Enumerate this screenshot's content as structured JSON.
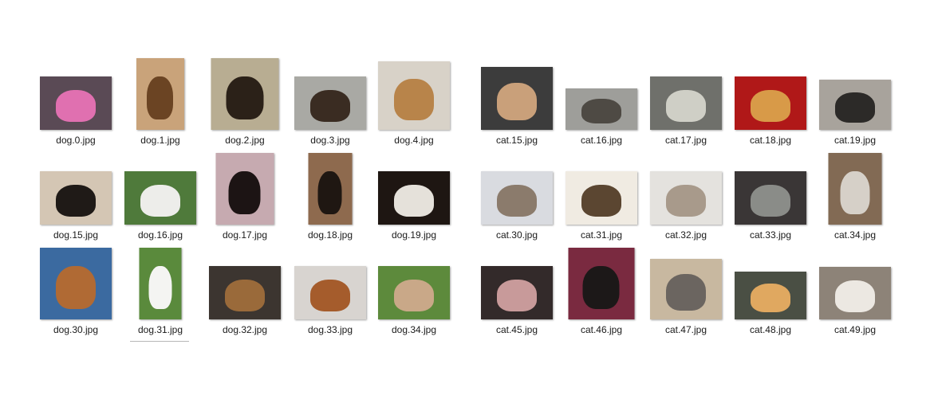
{
  "files": [
    {
      "name": "dog.0.jpg",
      "bg": "#5a4a55",
      "fg": "#e070b0"
    },
    {
      "name": "dog.1.jpg",
      "bg": "#c9a37a",
      "fg": "#6b4423"
    },
    {
      "name": "dog.2.jpg",
      "bg": "#b8ad92",
      "fg": "#2b2118"
    },
    {
      "name": "dog.3.jpg",
      "bg": "#a9a9a4",
      "fg": "#3a2c22"
    },
    {
      "name": "dog.4.jpg",
      "bg": "#d8d2c8",
      "fg": "#b8844a"
    },
    {
      "name": "cat.15.jpg",
      "bg": "#3c3c3c",
      "fg": "#c9a07a"
    },
    {
      "name": "cat.16.jpg",
      "bg": "#9e9e9a",
      "fg": "#4e4a44"
    },
    {
      "name": "cat.17.jpg",
      "bg": "#6f706b",
      "fg": "#cfcfc6"
    },
    {
      "name": "cat.18.jpg",
      "bg": "#b01818",
      "fg": "#d89a48"
    },
    {
      "name": "cat.19.jpg",
      "bg": "#a8a39c",
      "fg": "#2c2a28"
    },
    {
      "name": "dog.15.jpg",
      "bg": "#d4c6b4",
      "fg": "#1f1a17"
    },
    {
      "name": "dog.16.jpg",
      "bg": "#4f7a3b",
      "fg": "#ededea"
    },
    {
      "name": "dog.17.jpg",
      "bg": "#c6aab0",
      "fg": "#1c1414"
    },
    {
      "name": "dog.18.jpg",
      "bg": "#8e6a4e",
      "fg": "#1f1712"
    },
    {
      "name": "dog.19.jpg",
      "bg": "#1e1612",
      "fg": "#e5e1da"
    },
    {
      "name": "cat.30.jpg",
      "bg": "#d9dbe0",
      "fg": "#8b7b6c"
    },
    {
      "name": "cat.31.jpg",
      "bg": "#f0ebe2",
      "fg": "#5b4631"
    },
    {
      "name": "cat.32.jpg",
      "bg": "#e4e2de",
      "fg": "#a89a8b"
    },
    {
      "name": "cat.33.jpg",
      "bg": "#3a3636",
      "fg": "#8a8c88"
    },
    {
      "name": "cat.34.jpg",
      "bg": "#826a54",
      "fg": "#d6d0c8"
    },
    {
      "name": "dog.30.jpg",
      "bg": "#3b6aa0",
      "fg": "#b06a34"
    },
    {
      "name": "dog.31.jpg",
      "bg": "#5a8a3c",
      "fg": "#f4f4f2"
    },
    {
      "name": "dog.32.jpg",
      "bg": "#3c3530",
      "fg": "#9a6a3a"
    },
    {
      "name": "dog.33.jpg",
      "bg": "#d8d4d0",
      "fg": "#a55c2c"
    },
    {
      "name": "dog.34.jpg",
      "bg": "#5d8a3c",
      "fg": "#c9a888"
    },
    {
      "name": "cat.45.jpg",
      "bg": "#332a2a",
      "fg": "#c89a9a"
    },
    {
      "name": "cat.46.jpg",
      "bg": "#7a2a40",
      "fg": "#1c1818"
    },
    {
      "name": "cat.47.jpg",
      "bg": "#c8b8a0",
      "fg": "#6b6560"
    },
    {
      "name": "cat.48.jpg",
      "bg": "#4a4f44",
      "fg": "#e0a860"
    },
    {
      "name": "cat.49.jpg",
      "bg": "#8d8378",
      "fg": "#ece8e2"
    }
  ]
}
